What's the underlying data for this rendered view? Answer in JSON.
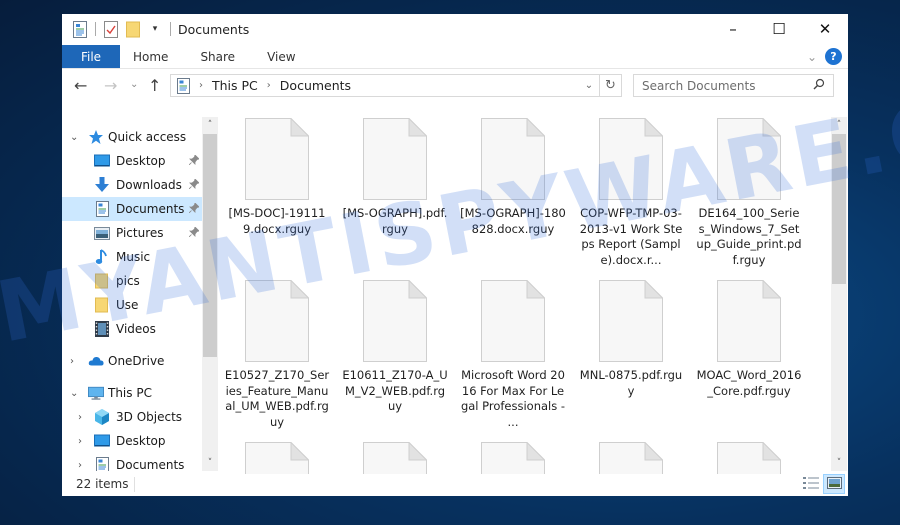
{
  "window": {
    "title": "Documents",
    "controls": {
      "minimize": "–",
      "maximize": "☐",
      "close": "✕"
    }
  },
  "quick_access_toolbar": {
    "icons": [
      "properties-icon",
      "new-folder-check-icon",
      "folder-icon",
      "customize-dropdown-icon"
    ]
  },
  "ribbon": {
    "tabs": [
      {
        "label": "File",
        "active": true
      },
      {
        "label": "Home"
      },
      {
        "label": "Share"
      },
      {
        "label": "View"
      }
    ],
    "expand_glyph": "⌄",
    "help_glyph": "?"
  },
  "navigation": {
    "back_glyph": "←",
    "forward_glyph": "→",
    "recent_glyph": "⌄",
    "up_glyph": "↑",
    "breadcrumb": [
      "This PC",
      "Documents"
    ],
    "breadcrumb_sep": "›",
    "dropdown_glyph": "⌄",
    "refresh_glyph": "↻",
    "search": {
      "placeholder": "Search Documents",
      "value": "",
      "icon_glyph": "⚲"
    }
  },
  "sidebar": {
    "items": [
      {
        "label": "Quick access",
        "icon": "star-icon",
        "chevron": "⌄",
        "level": 0
      },
      {
        "label": "Desktop",
        "icon": "desktop-icon",
        "pinned": true,
        "level": 1
      },
      {
        "label": "Downloads",
        "icon": "download-icon",
        "pinned": true,
        "level": 1
      },
      {
        "label": "Documents",
        "icon": "documents-icon",
        "pinned": true,
        "level": 1,
        "selected": true
      },
      {
        "label": "Pictures",
        "icon": "pictures-icon",
        "pinned": true,
        "level": 1
      },
      {
        "label": "Music",
        "icon": "music-icon",
        "level": 1
      },
      {
        "label": "pics",
        "icon": "folder-icon",
        "level": 1
      },
      {
        "label": "Use",
        "icon": "folder-icon",
        "level": 1
      },
      {
        "label": "Videos",
        "icon": "videos-icon",
        "level": 1
      },
      {
        "label": "OneDrive",
        "icon": "onedrive-icon",
        "chevron": "›",
        "level": 0
      },
      {
        "label": "This PC",
        "icon": "this-pc-icon",
        "chevron": "⌄",
        "level": 0
      },
      {
        "label": "3D Objects",
        "icon": "3d-objects-icon",
        "chevron": "›",
        "level": 1
      },
      {
        "label": "Desktop",
        "icon": "desktop-icon",
        "chevron": "›",
        "level": 1
      },
      {
        "label": "Documents",
        "icon": "documents-icon",
        "chevron": "›",
        "level": 1
      }
    ],
    "pin_glyph": "📌",
    "scroll_up": "˄",
    "scroll_down": "˅"
  },
  "files": [
    {
      "name": "[MS-DOC]-191119.docx.rguy"
    },
    {
      "name": "[MS-OGRAPH].pdf.rguy"
    },
    {
      "name": "[MS-OGRAPH]-180828.docx.rguy"
    },
    {
      "name": "COP-WFP-TMP-03-2013-v1 Work Steps Report (Sample).docx.r..."
    },
    {
      "name": "DE164_100_Series_Windows_7_Setup_Guide_print.pdf.rguy"
    },
    {
      "name": "E10527_Z170_Series_Feature_Manual_UM_WEB.pdf.rguy"
    },
    {
      "name": "E10611_Z170-A_UM_V2_WEB.pdf.rguy"
    },
    {
      "name": "Microsoft Word 2016 For Max For Legal Professionals - ..."
    },
    {
      "name": "MNL-0875.pdf.rguy"
    },
    {
      "name": "MOAC_Word_2016_Core.pdf.rguy"
    },
    {
      "name": ""
    },
    {
      "name": ""
    },
    {
      "name": ""
    },
    {
      "name": ""
    },
    {
      "name": ""
    }
  ],
  "content_scroll": {
    "up": "˄",
    "down": "˅"
  },
  "status": {
    "item_count": "22 items",
    "views": [
      "details-view-icon",
      "large-icons-view-icon"
    ],
    "active_view": "large-icons-view-icon"
  },
  "watermark": "MYANTISPYWARE.COM",
  "colors": {
    "accent": "#1e67b8",
    "selection": "#cce8ff",
    "desktop": "#07315f"
  }
}
